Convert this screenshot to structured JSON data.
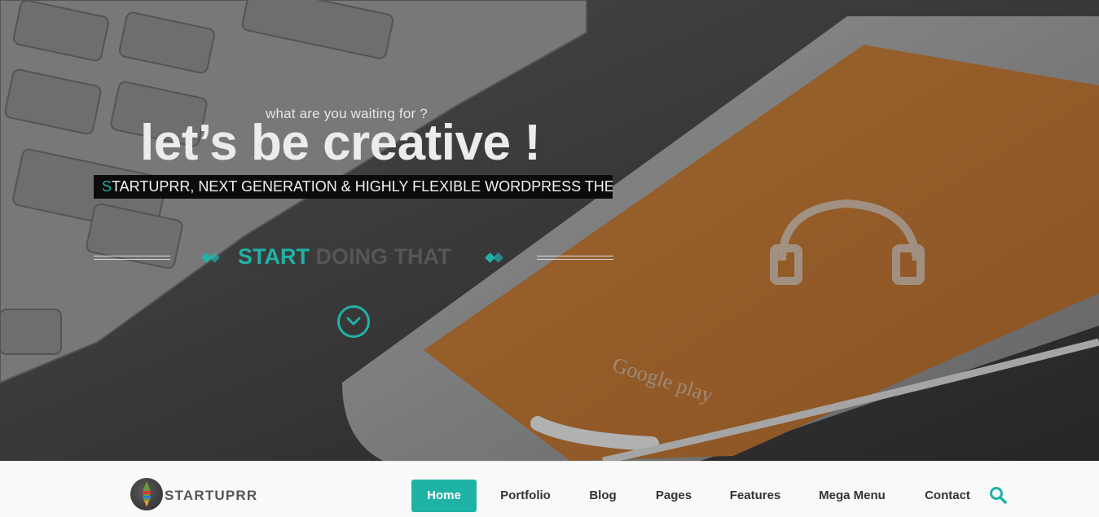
{
  "hero": {
    "tagline_small": "what are you waiting for ?",
    "headline": "let’s be creative !",
    "banner_accent": "S",
    "banner_brand": "TARTUPRR",
    "banner_rest": ", NEXT GENERATION & HIGHLY FLEXIBLE WORDPRESS THEME",
    "cta_strong": "START",
    "cta_faint": " DOING THAT",
    "phone_store_text": "Google play"
  },
  "nav": {
    "logo_text": "STARTUPRR",
    "items": [
      {
        "label": "Home",
        "active": true
      },
      {
        "label": "Portfolio",
        "active": false
      },
      {
        "label": "Blog",
        "active": false
      },
      {
        "label": "Pages",
        "active": false
      },
      {
        "label": "Features",
        "active": false
      },
      {
        "label": "Mega Menu",
        "active": false
      },
      {
        "label": "Contact",
        "active": false
      }
    ],
    "search_icon": "search-icon"
  },
  "colors": {
    "accent": "#1fb3a6",
    "banner_bg": "#0b0b0b",
    "phone_screen": "#c77a32",
    "nav_bg": "#f9f9f9"
  }
}
